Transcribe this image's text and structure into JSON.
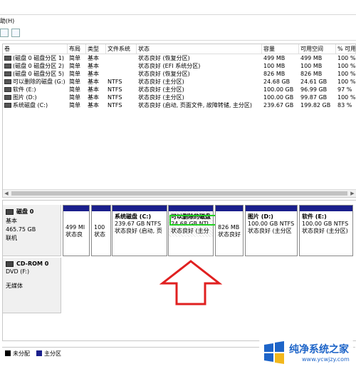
{
  "menu": {
    "help_label": "助(H)"
  },
  "list": {
    "columns": [
      "卷",
      "布局",
      "类型",
      "文件系统",
      "状态",
      "容量",
      "可用空间",
      "% 可用"
    ],
    "rows": [
      [
        "(磁盘 0 磁盘分区 1)",
        "简单",
        "基本",
        "",
        "状态良好 (恢复分区)",
        "499 MB",
        "499 MB",
        "100 %"
      ],
      [
        "(磁盘 0 磁盘分区 2)",
        "简单",
        "基本",
        "",
        "状态良好 (EFI 系统分区)",
        "100 MB",
        "100 MB",
        "100 %"
      ],
      [
        "(磁盘 0 磁盘分区 5)",
        "简单",
        "基本",
        "",
        "状态良好 (恢复分区)",
        "826 MB",
        "826 MB",
        "100 %"
      ],
      [
        "可以删除的磁盘 (G:)",
        "简单",
        "基本",
        "NTFS",
        "状态良好 (主分区)",
        "24.68 GB",
        "24.61 GB",
        "100 %"
      ],
      [
        "软件 (E:)",
        "简单",
        "基本",
        "NTFS",
        "状态良好 (主分区)",
        "100.00 GB",
        "96.99 GB",
        "97 %"
      ],
      [
        "图片 (D:)",
        "简单",
        "基本",
        "NTFS",
        "状态良好 (主分区)",
        "100.00 GB",
        "99.87 GB",
        "100 %"
      ],
      [
        "系统磁盘 (C:)",
        "简单",
        "基本",
        "NTFS",
        "状态良好 (启动, 页面文件, 故障转储, 主分区)",
        "239.67 GB",
        "199.82 GB",
        "83 %"
      ]
    ]
  },
  "disk0": {
    "name": "磁盘 0",
    "type": "基本",
    "size": "465.75 GB",
    "status": "联机",
    "partitions": [
      {
        "title": "",
        "line1": "499 MI",
        "line2": "状态良"
      },
      {
        "title": "",
        "line1": "100",
        "line2": "状态"
      },
      {
        "title": "系统磁盘  (C:)",
        "line1": "239.67 GB NTFS",
        "line2": "状态良好 (启动, 页"
      },
      {
        "title": "可以删除的磁盘  (G:)",
        "line1": "24.68 GB NTI",
        "line2": "状态良好 (主分"
      },
      {
        "title": "",
        "line1": "826 MB",
        "line2": "状态良好"
      },
      {
        "title": "图片  (D:)",
        "line1": "100.00 GB NTFS",
        "line2": "状态良好 (主分区"
      },
      {
        "title": "软件  (E:)",
        "line1": "100.00 GB NTFS",
        "line2": "状态良好 (主分区)"
      }
    ]
  },
  "cdrom0": {
    "name": "CD-ROM 0",
    "type": "DVD (F:)",
    "status": "无媒体"
  },
  "legend": {
    "unallocated": "未分配",
    "primary": "主分区"
  },
  "watermark": {
    "name": "纯净系统之家",
    "url": "www.ycwjzy.com"
  },
  "colors": {
    "primary_partition": "#1a1f8c",
    "unallocated": "#000000",
    "highlight_box": "#21d021",
    "annotation_arrow": "#e02020"
  }
}
